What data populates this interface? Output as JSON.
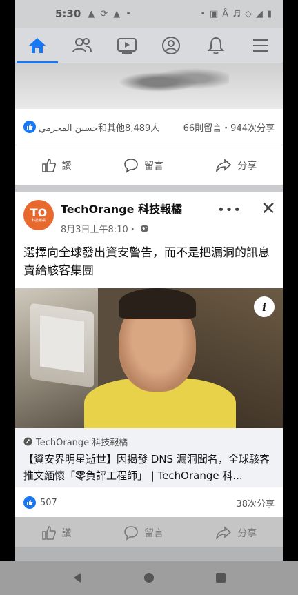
{
  "status_bar": {
    "time": "5:30"
  },
  "top_nav": {
    "items": [
      {
        "name": "home"
      },
      {
        "name": "friends"
      },
      {
        "name": "watch"
      },
      {
        "name": "profile"
      },
      {
        "name": "notifications"
      },
      {
        "name": "menu"
      }
    ],
    "accent": "#1877f2"
  },
  "prev_post": {
    "reactions_text": "حسين المحرمي和其他8,489人",
    "comments_shares": "66則留言・944次分享",
    "actions": {
      "like": "讚",
      "comment": "留言",
      "share": "分享"
    }
  },
  "post": {
    "author": "TechOrange 科技報橘",
    "avatar_text": "TO",
    "time": "8月3日上午8:10・",
    "text": "選擇向全球發出資安警告，而不是把漏洞的訊息賣給駭客集團",
    "link": {
      "source": "TechOrange 科技報橘",
      "title": "【資安界明星逝世】因揭發 DNS 漏洞聞名，全球駭客推文緬懷「零負評工程師」 | TechOrange 科..."
    },
    "likes": "507",
    "shares": "38次分享",
    "actions": {
      "like": "讚",
      "comment": "留言",
      "share": "分享"
    }
  }
}
